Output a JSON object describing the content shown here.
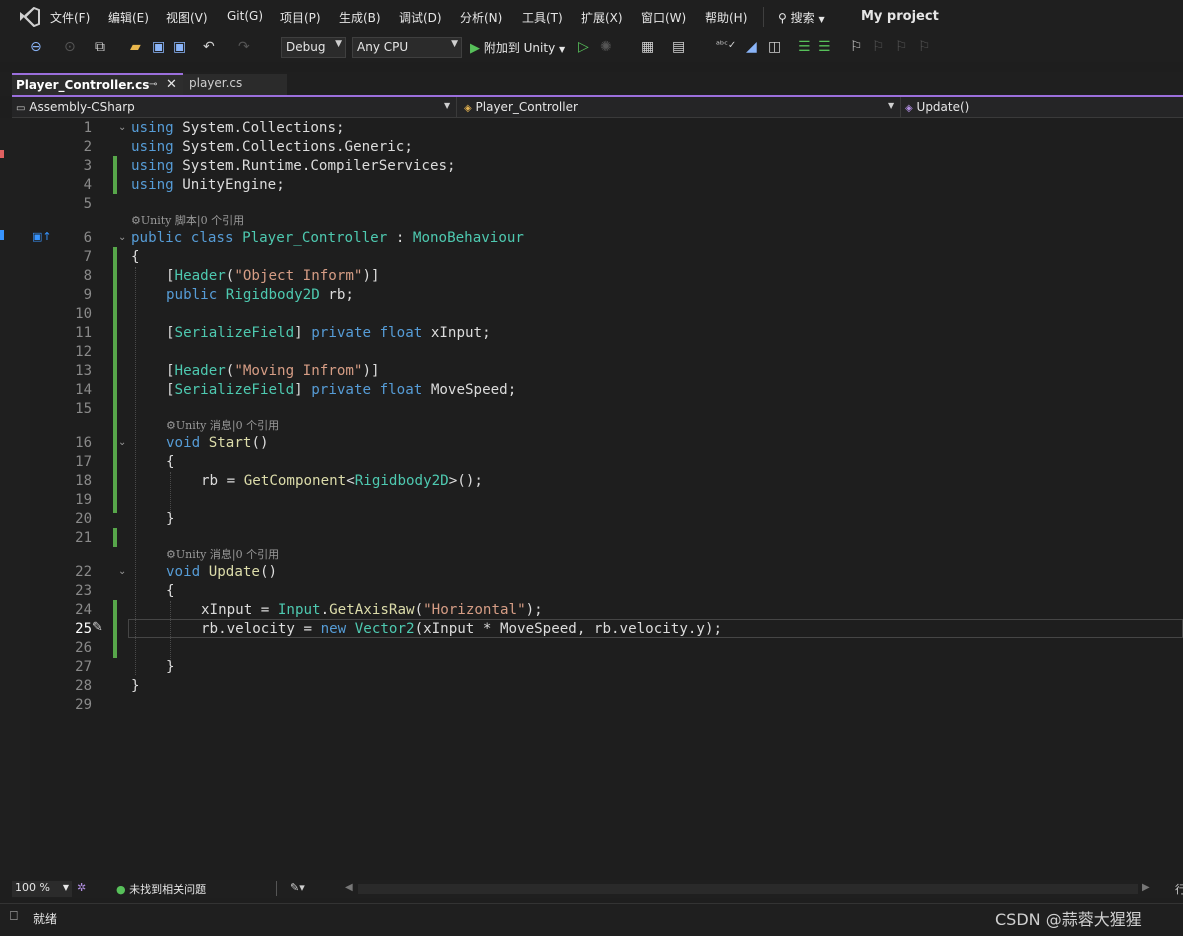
{
  "menu": {
    "items": [
      "文件(F)",
      "编辑(E)",
      "视图(V)",
      "Git(G)",
      "项目(P)",
      "生成(B)",
      "调试(D)",
      "分析(N)",
      "工具(T)",
      "扩展(X)",
      "窗口(W)",
      "帮助(H)"
    ],
    "search_label": "搜索",
    "project_title": "My project"
  },
  "toolbar": {
    "config": "Debug",
    "platform": "Any CPU",
    "attach_label": "附加到 Unity"
  },
  "tabs": [
    {
      "label": "Player_Controller.cs",
      "active": true
    },
    {
      "label": "player.cs",
      "active": false
    }
  ],
  "navbar": {
    "project": "Assembly-CSharp",
    "class": "Player_Controller",
    "member": "Update()"
  },
  "codelens": {
    "class": "Unity 脚本|0 个引用",
    "start": "Unity 消息|0 个引用",
    "update": "Unity 消息|0 个引用"
  },
  "code": {
    "l1": {
      "kw": "using",
      "rest": " System.Collections;"
    },
    "l2": {
      "kw": "using",
      "rest": " System.Collections.Generic;"
    },
    "l3": {
      "kw": "using",
      "rest": " System.Runtime.CompilerServices;"
    },
    "l4": {
      "kw": "using",
      "rest": " UnityEngine;"
    },
    "l6": {
      "kw1": "public",
      "kw2": "class",
      "cls": "Player_Controller",
      "sep": " : ",
      "base": "MonoBehaviour"
    },
    "l7": "{",
    "l8": {
      "open": "[",
      "attr": "Header",
      "p1": "(",
      "str": "\"Object Inform\"",
      "p2": ")]"
    },
    "l9": {
      "kw": "public",
      "ty": "Rigidbody2D",
      "rest": " rb;"
    },
    "l11": {
      "open": "[",
      "attr": "SerializeField",
      "close": "] ",
      "kw1": "private",
      "kw2": "float",
      "rest": " xInput;"
    },
    "l13": {
      "open": "[",
      "attr": "Header",
      "p1": "(",
      "str": "\"Moving Infrom\"",
      "p2": ")]"
    },
    "l14": {
      "open": "[",
      "attr": "SerializeField",
      "close": "] ",
      "kw1": "private",
      "kw2": "float",
      "rest": " MoveSpeed;"
    },
    "l16": {
      "kw": "void",
      "fn": "Start",
      "rest": "()"
    },
    "l17": "{",
    "l18": {
      "pre": "rb = ",
      "fn": "GetComponent",
      "lt": "<",
      "ty": "Rigidbody2D",
      "rest": ">();"
    },
    "l20": "}",
    "l22": {
      "kw": "void",
      "fn": "Update",
      "rest": "()"
    },
    "l23": "{",
    "l24": {
      "pre": "xInput = ",
      "ty": "Input",
      "dot": ".",
      "fn": "GetAxisRaw",
      "p1": "(",
      "str": "\"Horizontal\"",
      "p2": ");"
    },
    "l25": {
      "pre": "rb.velocity = ",
      "kw": "new",
      "ty": "Vector2",
      "rest": "(xInput * MoveSpeed, rb.velocity.y);"
    },
    "l27": "}",
    "l28": "}"
  },
  "editor_status": {
    "zoom": "100 %",
    "issues": "未找到相关问题"
  },
  "statusbar": {
    "ready": "就绪",
    "watermark": "CSDN @蒜蓉大猩猩",
    "right_char": "行"
  },
  "colors": {
    "accent": "#9b6fdc",
    "keyword": "#569cd6",
    "type": "#4ec9b0",
    "method": "#dcdcaa",
    "string": "#d69d85",
    "change_bar": "#57a64a"
  }
}
